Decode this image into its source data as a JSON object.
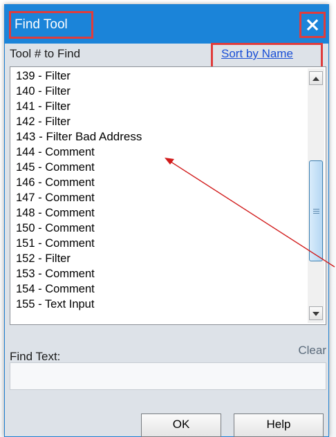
{
  "window": {
    "title": "Find Tool",
    "close_icon": "close-icon"
  },
  "list": {
    "label": "Tool # to Find",
    "sort_link": "Sort by Name",
    "items": [
      "139 - Filter",
      "140 - Filter",
      "141 - Filter",
      "142 - Filter",
      "143 - Filter Bad Address",
      "144 - Comment",
      "145 - Comment",
      "146 - Comment",
      "147 - Comment",
      "148 - Comment",
      "150 - Comment",
      "151 - Comment",
      "152 - Filter",
      "153 - Comment",
      "154 - Comment",
      "155 - Text Input"
    ]
  },
  "find": {
    "label": "Find Text:",
    "clear_label": "Clear",
    "value": ""
  },
  "buttons": {
    "ok": "OK",
    "help": "Help"
  },
  "colors": {
    "titlebar": "#1b84d9",
    "highlight_box": "#e03c3c",
    "annotation_arrow": "#d11a1a",
    "link": "#1a4fd6"
  }
}
